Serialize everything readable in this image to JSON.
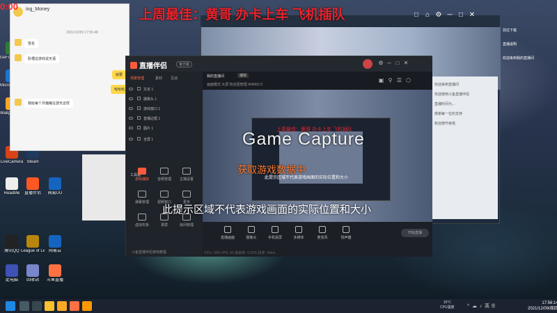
{
  "screen": {
    "top_banner": "上周最佳：黄哥 办卡上车 飞机插队",
    "corner_badge": "0:00"
  },
  "chat_window": {
    "title": "ing_Money",
    "timestamp": "2021/12/09 17:55:48",
    "messages": [
      "签名",
      "卧槽这游戏说无语",
      "我给每个月偏瘫在游天这样"
    ],
    "right_bubbles": [
      "就要",
      "哈哈哈"
    ]
  },
  "desktop_icons": [
    {
      "label": "GeForce Experience",
      "color": "#2e7d32"
    },
    {
      "label": "Microsoft Edge",
      "color": "#1976d2"
    },
    {
      "label": "Wallpaper Engine",
      "color": "#f9a825"
    },
    {
      "label": "LiveCamera",
      "color": "#d84315"
    },
    {
      "label": "Steam",
      "color": "#1e3a5f"
    },
    {
      "label": "ReadMe",
      "color": "#eeeeee"
    },
    {
      "label": "直播伴侣",
      "color": "#ff5722"
    },
    {
      "label": "网易UU",
      "color": "#1565c0"
    },
    {
      "label": "腾讯QQ",
      "color": "#222222"
    },
    {
      "label": "League of Legends",
      "color": "#b8860b"
    },
    {
      "label": "网易云",
      "color": "#1565c0"
    },
    {
      "label": "此电脑",
      "color": "#3f51b5"
    },
    {
      "label": "回收站",
      "color": "#7986cb"
    },
    {
      "label": "斗鱼直播",
      "color": "#ff7043"
    }
  ],
  "bg_window": {
    "controls": [
      "□",
      "⌂",
      "⚙",
      "─",
      "□",
      "✕"
    ],
    "right_chat_lines": [
      "欢迎来到直播间",
      "欢迎使用斗鱼直播伴侣",
      "直播时间为...",
      "感谢每一位的支持",
      "粉丝牌升级啦"
    ],
    "right_labels": [
      "前往下载",
      "直播说明",
      "欢迎来到我的直播间"
    ]
  },
  "main_window": {
    "logo": "直播伴侣",
    "beta": "官方版",
    "controls": [
      "⚙",
      "─",
      "□",
      "✕"
    ],
    "tabs": [
      "场景管理",
      "素材",
      "互动"
    ],
    "sources": [
      "文本 1",
      "摄像头 1",
      "游戏窗口 1",
      "直播边框 1",
      "图片 1",
      "全屏 1"
    ],
    "toolbox_label": "工具箱",
    "tools": [
      {
        "label": "游戏捕获",
        "red": true
      },
      {
        "label": "音频管理",
        "red": false
      },
      {
        "label": "主播设置",
        "red": false
      },
      {
        "label": "弹幕管理",
        "red": false
      },
      {
        "label": "视频窗口",
        "red": false
      },
      {
        "label": "更多",
        "red": false
      },
      {
        "label": "虚拟形象",
        "red": false
      },
      {
        "label": "录屏",
        "red": false
      },
      {
        "label": "房间管理",
        "red": false
      }
    ],
    "left_footer": "斗鱼直播伴侣使用教程",
    "room": {
      "title": "我的直播间",
      "tag": "编辑",
      "meta": "画面模式   大屏   粉丝团管理   404052   0"
    },
    "room_icons": [
      "▣",
      "⚲",
      "☰",
      "⬡"
    ],
    "preview_banner": "上周最佳：黄哥 办卡上车 飞机插队",
    "bottom_items": [
      "直播画面",
      "摄像头",
      "手机投屏",
      "多媒体",
      "麦克风",
      "扬声器"
    ],
    "go_live": "开始直播",
    "status": "CPU: 18%   FPS: 60   丢帧率: 0.00%   码率: 0kb/s"
  },
  "capture_overlay": {
    "title": "Game Capture",
    "status": "获取游戏数据中",
    "hint_small": "此提示区域不代表游戏画面的实际位置和大小",
    "hint_big": "此提示区域不代表游戏画面的实际位置和大小"
  },
  "taskbar": {
    "weather_temp": "15°C",
    "weather_desc": "CPU温度",
    "tray": [
      "^",
      "☁",
      "♪",
      "英",
      "☰"
    ],
    "time": "17:56:14",
    "date": "2021/12/09/周四"
  }
}
